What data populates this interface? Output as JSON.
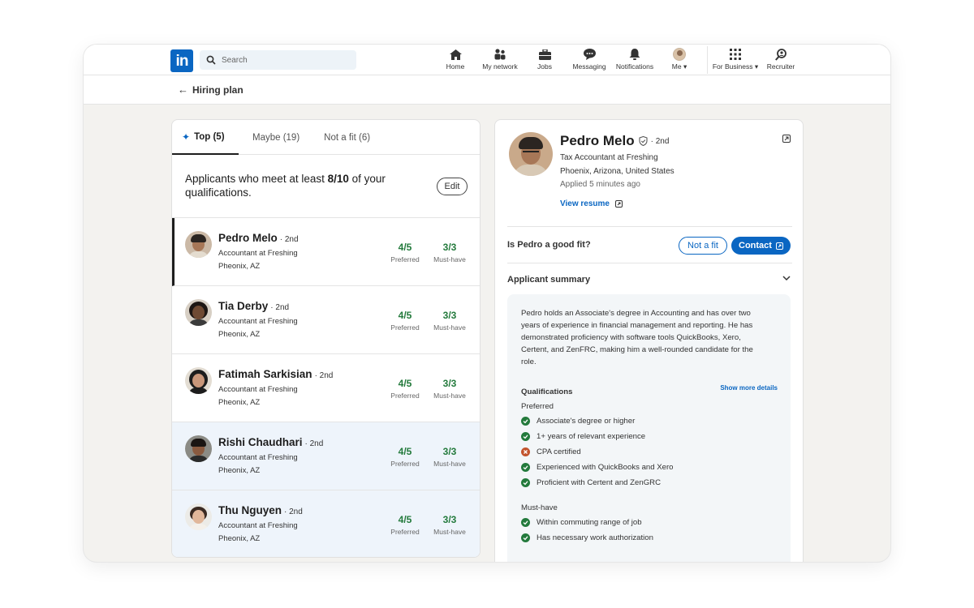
{
  "nav": {
    "search_placeholder": "Search",
    "items": [
      {
        "label": "Home",
        "icon": "home-icon"
      },
      {
        "label": "My network",
        "icon": "network-icon"
      },
      {
        "label": "Jobs",
        "icon": "briefcase-icon"
      },
      {
        "label": "Messaging",
        "icon": "message-icon"
      },
      {
        "label": "Notifications",
        "icon": "bell-icon"
      },
      {
        "label": "Me",
        "icon": "avatar"
      },
      {
        "label": "For Business",
        "icon": "grid-icon"
      },
      {
        "label": "Recruiter",
        "icon": "recruiter-icon"
      }
    ]
  },
  "subheader": {
    "back_label": "Hiring plan"
  },
  "tabs": [
    {
      "label": "Top (5)",
      "active": true
    },
    {
      "label": "Maybe (19)",
      "active": false
    },
    {
      "label": "Not a fit (6)",
      "active": false
    }
  ],
  "criteria": {
    "prefix": "Applicants who meet at least ",
    "threshold": "8/10",
    "suffix": " of your qualifications.",
    "edit_label": "Edit"
  },
  "applicants": [
    {
      "name": "Pedro Melo",
      "degree": "· 2nd",
      "title": "Accountant at Freshing",
      "location": "Pheonix, AZ",
      "preferred": "4/5",
      "preferred_label": "Preferred",
      "must": "3/3",
      "must_label": "Must-have"
    },
    {
      "name": "Tia Derby",
      "degree": "· 2nd",
      "title": "Accountant at Freshing",
      "location": "Pheonix, AZ",
      "preferred": "4/5",
      "preferred_label": "Preferred",
      "must": "3/3",
      "must_label": "Must-have"
    },
    {
      "name": "Fatimah Sarkisian",
      "degree": "· 2nd",
      "title": "Accountant at Freshing",
      "location": "Pheonix, AZ",
      "preferred": "4/5",
      "preferred_label": "Preferred",
      "must": "3/3",
      "must_label": "Must-have"
    },
    {
      "name": "Rishi Chaudhari",
      "degree": "· 2nd",
      "title": "Accountant at Freshing",
      "location": "Pheonix, AZ",
      "preferred": "4/5",
      "preferred_label": "Preferred",
      "must": "3/3",
      "must_label": "Must-have"
    },
    {
      "name": "Thu Nguyen",
      "degree": "· 2nd",
      "title": "Accountant at Freshing",
      "location": "Pheonix, AZ",
      "preferred": "4/5",
      "preferred_label": "Preferred",
      "must": "3/3",
      "must_label": "Must-have"
    }
  ],
  "profile": {
    "name": "Pedro Melo",
    "degree": "· 2nd",
    "title": "Tax Accountant at Freshing",
    "location": "Phoenix, Arizona, United States",
    "applied": "Applied 5 minutes ago",
    "view_resume": "View resume",
    "fit_question": "Is Pedro a good fit?",
    "not_fit_label": "Not a fit",
    "contact_label": "Contact",
    "summary_title": "Applicant summary",
    "summary_text": "Pedro holds an Associate's degree in Accounting and has over two years of experience in financial management and reporting. He has demonstrated proficiency with software tools QuickBooks, Xero, Certent, and ZenFRC, making him a well-rounded candidate for the role.",
    "qualifications_label": "Qualifications",
    "show_more": "Show more details",
    "preferred_label": "Preferred",
    "preferred": [
      {
        "text": "Associate's degree or higher",
        "met": true
      },
      {
        "text": "1+ years of relevant experience",
        "met": true
      },
      {
        "text": "CPA certified",
        "met": false
      },
      {
        "text": "Experienced with QuickBooks and Xero",
        "met": true
      },
      {
        "text": "Proficient with Certent and ZenGRC",
        "met": true
      }
    ],
    "must_label": "Must-have",
    "must": [
      {
        "text": "Within commuting range of job",
        "met": true
      },
      {
        "text": "Has necessary work authorization",
        "met": true
      }
    ]
  },
  "colors": {
    "brand": "#0a66c2",
    "success": "#237a3c",
    "fail": "#c2542d",
    "selected_tint": "#eef4fb"
  }
}
